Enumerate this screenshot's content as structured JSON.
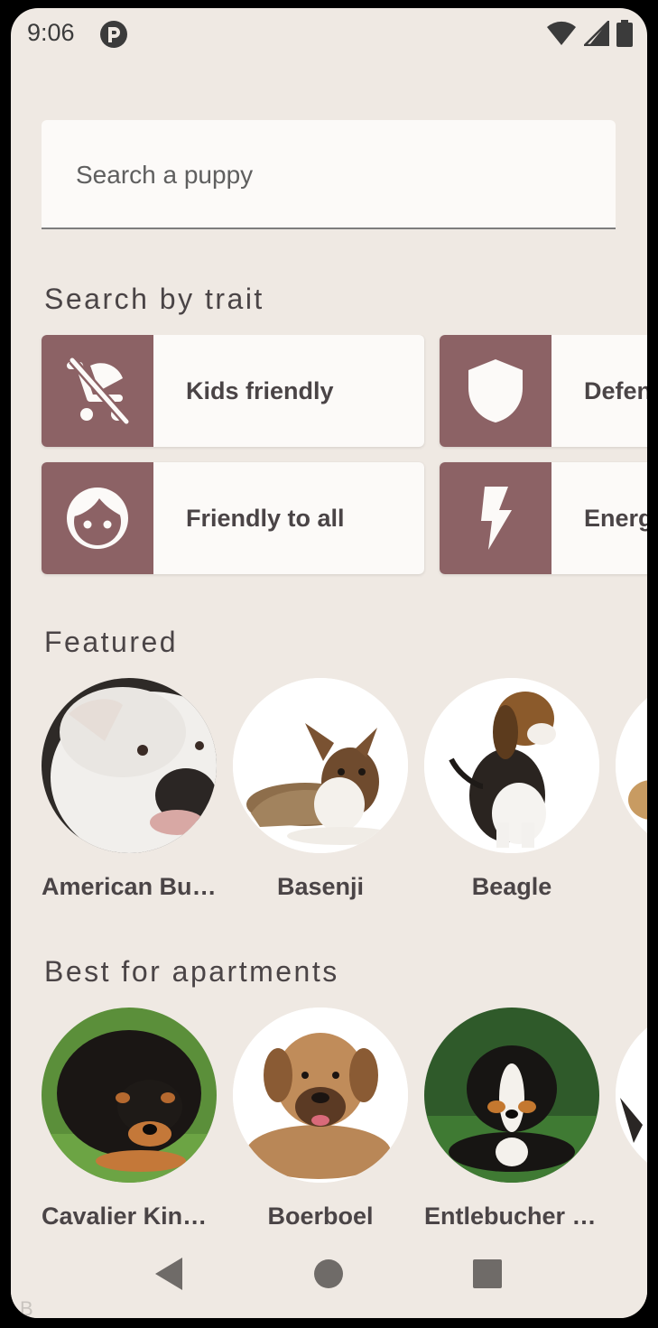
{
  "status_bar": {
    "time": "9:06",
    "app_icon": "app-notification-icon",
    "wifi_icon": "wifi-icon",
    "signal_icon": "cell-signal-icon",
    "battery_icon": "battery-icon"
  },
  "search": {
    "placeholder": "Search a puppy",
    "value": ""
  },
  "sections": {
    "traits_title": "Search by trait",
    "featured_title": "Featured",
    "apartments_title": "Best for apartments"
  },
  "traits": [
    {
      "label": "Kids friendly",
      "icon": "no-stroller-icon"
    },
    {
      "label": "Defensive",
      "icon": "shield-icon"
    },
    {
      "label": "Friendly to all",
      "icon": "face-icon"
    },
    {
      "label": "Energetic",
      "icon": "lightning-bolt-icon"
    }
  ],
  "featured": [
    {
      "name": "American Bulldog"
    },
    {
      "name": "Basenji"
    },
    {
      "name": "Beagle"
    },
    {
      "name": ""
    }
  ],
  "apartments": [
    {
      "name": "Cavalier King Charles Spaniel"
    },
    {
      "name": "Boerboel"
    },
    {
      "name": "Entlebucher Mountain Dog"
    },
    {
      "name": ""
    }
  ],
  "nav": {
    "back_icon": "back-triangle-icon",
    "home_icon": "home-circle-icon",
    "recents_icon": "recents-square-icon"
  },
  "corner_text": "B",
  "colors": {
    "background": "#efe9e3",
    "surface": "#fcfaf8",
    "accent": "#8c6265",
    "text": "#4a4446"
  }
}
